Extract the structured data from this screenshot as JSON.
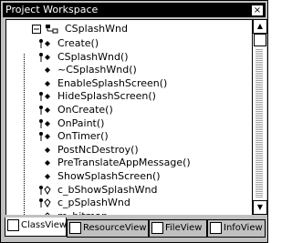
{
  "window": {
    "title": "Project Workspace",
    "close_glyph": "×"
  },
  "tree": {
    "class_name": "CSplashWnd",
    "members": [
      {
        "label": "Create()",
        "kind": "public-method"
      },
      {
        "label": "CSplashWnd()",
        "kind": "public-method"
      },
      {
        "label": "~CSplashWnd()",
        "kind": "method"
      },
      {
        "label": "EnableSplashScreen()",
        "kind": "method"
      },
      {
        "label": "HideSplashScreen()",
        "kind": "public-method"
      },
      {
        "label": "OnCreate()",
        "kind": "public-method"
      },
      {
        "label": "OnPaint()",
        "kind": "public-method"
      },
      {
        "label": "OnTimer()",
        "kind": "public-method"
      },
      {
        "label": "PostNcDestroy()",
        "kind": "method"
      },
      {
        "label": "PreTranslateAppMessage()",
        "kind": "method"
      },
      {
        "label": "ShowSplashScreen()",
        "kind": "method"
      },
      {
        "label": "c_bShowSplashWnd",
        "kind": "public-var"
      },
      {
        "label": "c_pSplashWnd",
        "kind": "public-var"
      },
      {
        "label": "m_bitmap",
        "kind": "var"
      }
    ]
  },
  "tabs": [
    {
      "label": "ClassView",
      "icon": "classview-icon",
      "active": true
    },
    {
      "label": "ResourceView",
      "icon": "resourceview-icon",
      "active": false
    },
    {
      "label": "FileView",
      "icon": "fileview-icon",
      "active": false
    },
    {
      "label": "InfoView",
      "icon": "infoview-icon",
      "active": false
    }
  ]
}
